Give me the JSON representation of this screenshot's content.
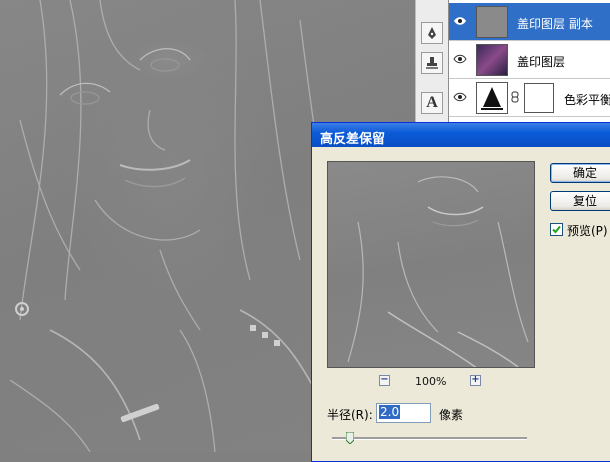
{
  "dialog": {
    "title": "高反差保留",
    "ok_label": "确定",
    "reset_label": "复位",
    "preview_label": "预览(P)",
    "preview_checked": true,
    "zoom_level": "100%",
    "zoom_out_label": "−",
    "zoom_in_label": "+",
    "radius_label": "半径(R):",
    "radius_value": "2.0",
    "radius_unit": "像素",
    "radius_slider_fraction": 0.09
  },
  "layers": {
    "items": [
      {
        "name": "盖印图层 副本",
        "visible": true,
        "selected": true
      },
      {
        "name": "盖印图层",
        "visible": true,
        "selected": false
      },
      {
        "name": "色彩平衡",
        "visible": true,
        "selected": false
      }
    ]
  },
  "toolbar": {
    "tools": [
      "pen-icon",
      "stamp-icon",
      "type-icon"
    ],
    "type_tool_glyph": "A"
  },
  "colors": {
    "title_bar": "#0b5bd8",
    "selected_layer": "#2f6fc7",
    "dialog_bg": "#ece9d8",
    "canvas_gray": "#808080"
  }
}
